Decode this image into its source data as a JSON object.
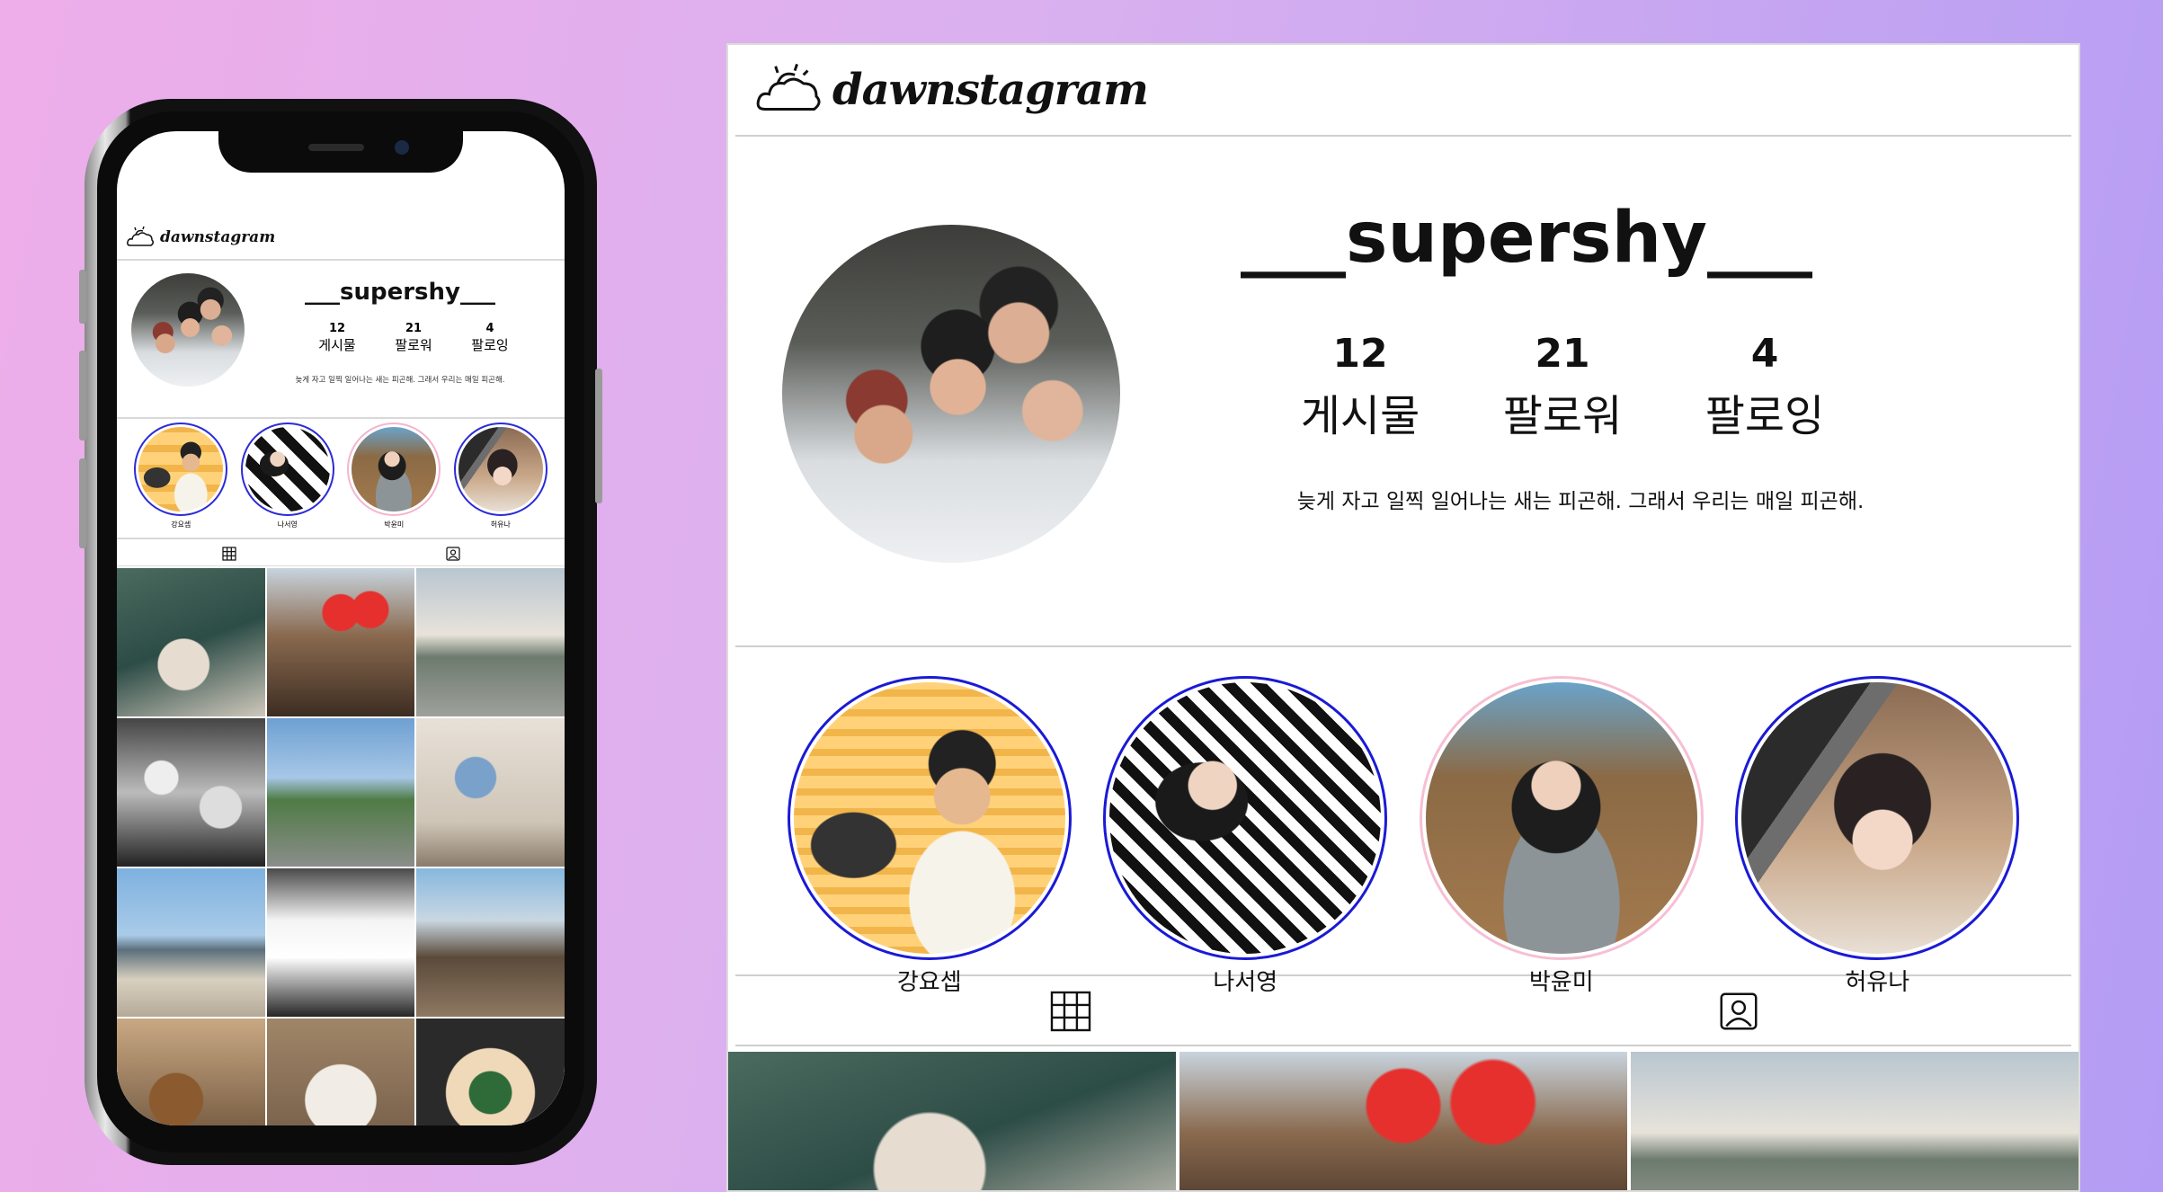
{
  "app": {
    "logo_text": "dawnstagram"
  },
  "profile": {
    "username": "___supershy___",
    "stats": [
      {
        "count": "12",
        "label": "게시물"
      },
      {
        "count": "21",
        "label": "팔로워"
      },
      {
        "count": "4",
        "label": "팔로잉"
      }
    ],
    "bio": "늦게 자고 일찍 일어나는 새는 피곤해. 그래서 우리는 매일 피곤해."
  },
  "stories": [
    {
      "name": "강요셉",
      "ring_color": "#1a1ad6"
    },
    {
      "name": "나서영",
      "ring_color": "#1a1ad6"
    },
    {
      "name": "박윤미",
      "ring_color": "#f7bfd3"
    },
    {
      "name": "허유나",
      "ring_color": "#1a1ad6"
    }
  ],
  "tabs": [
    {
      "icon": "grid-icon"
    },
    {
      "icon": "tagged-user-icon"
    }
  ],
  "colors": {
    "story_ring": "#1a1ad6",
    "story_ring_alt": "#f7bfd3",
    "background_start": "#eeaee9",
    "background_end": "#b49cf4"
  }
}
